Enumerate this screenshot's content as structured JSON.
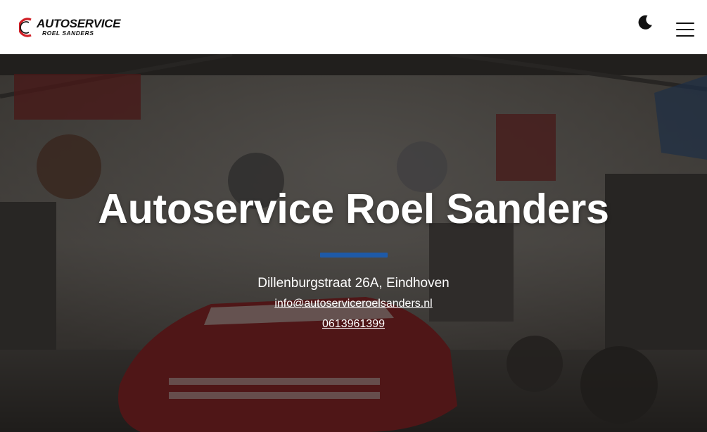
{
  "header": {
    "logo": {
      "title": "AUTOSERVICE",
      "subtitle": "ROEL SANDERS"
    },
    "theme_toggle_icon": "moon-icon",
    "menu_icon": "hamburger-menu-icon"
  },
  "hero": {
    "title": "Autoservice Roel Sanders",
    "address": "Dillenburgstraat 26A, Eindhoven",
    "email": "info@autoserviceroelsanders.nl",
    "phone": "0613961399",
    "accent_color": "#1e5aa8"
  }
}
